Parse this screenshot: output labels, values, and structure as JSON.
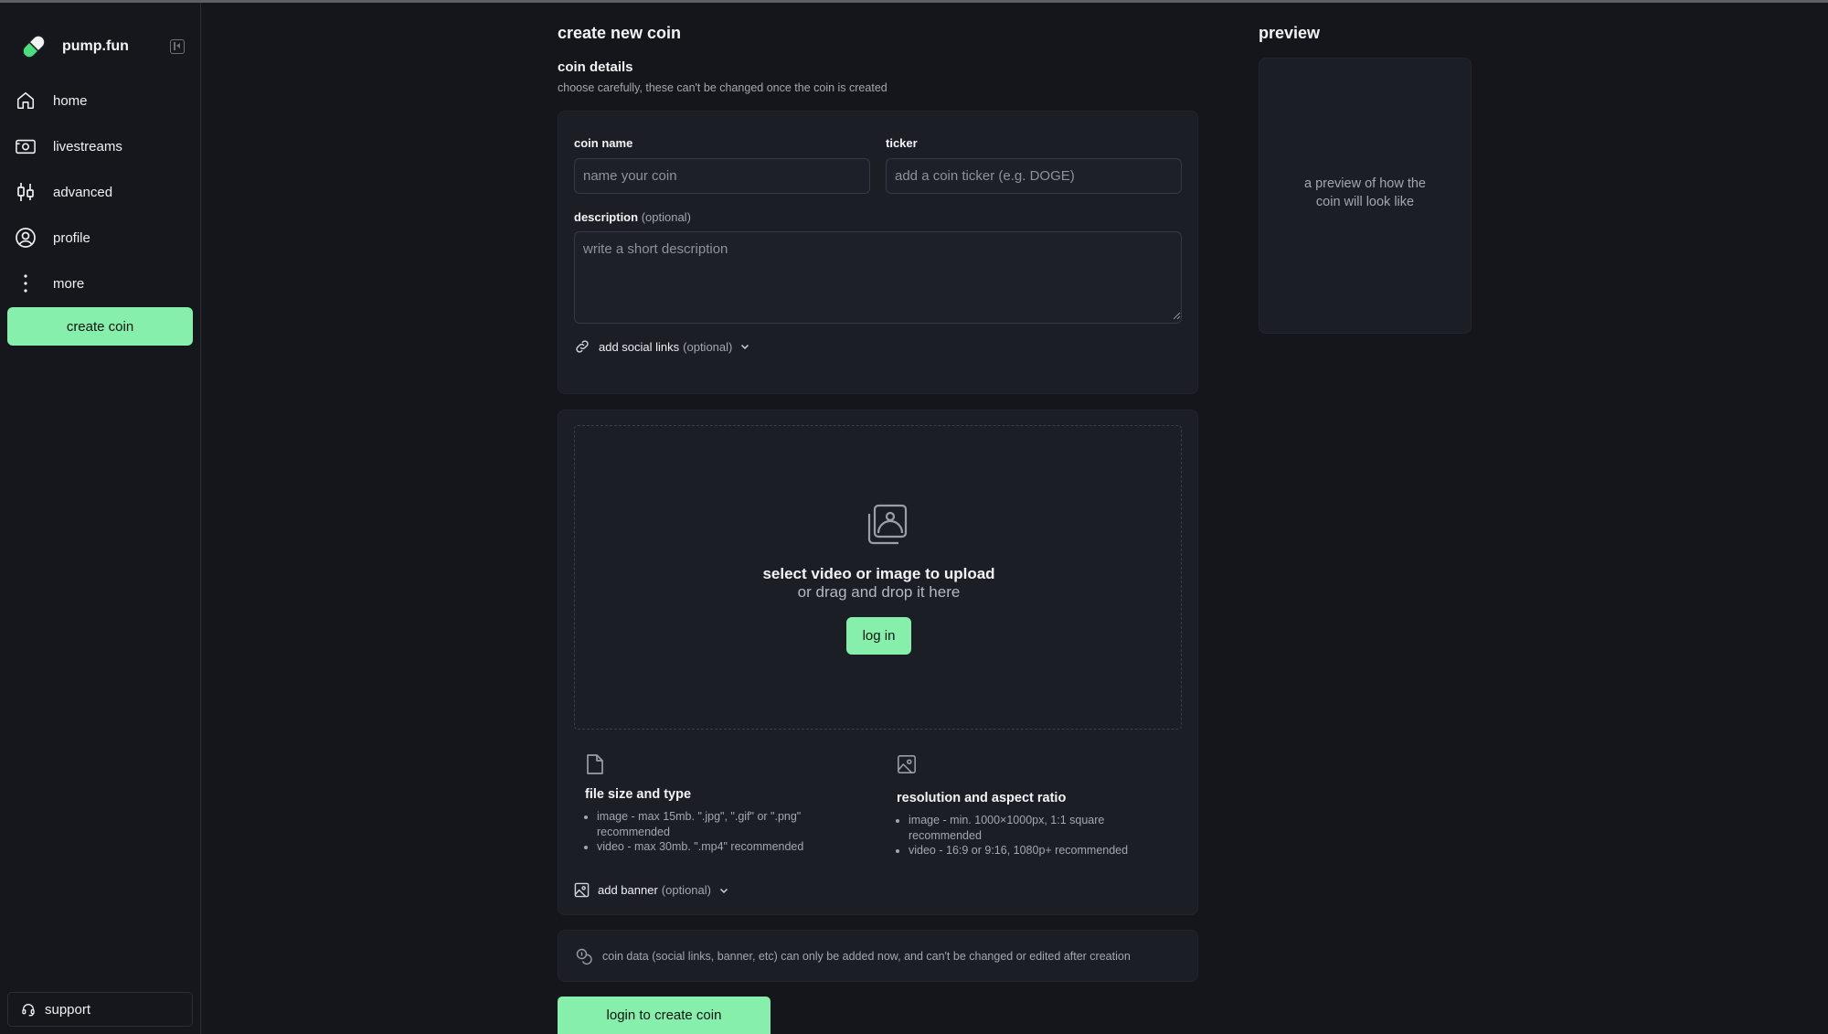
{
  "app": {
    "name": "pump.fun"
  },
  "sidebar": {
    "items": [
      {
        "label": "home",
        "icon": "home-icon"
      },
      {
        "label": "livestreams",
        "icon": "camera-icon"
      },
      {
        "label": "advanced",
        "icon": "candlestick-icon"
      },
      {
        "label": "profile",
        "icon": "user-circle-icon"
      },
      {
        "label": "more",
        "icon": "more-vertical-icon"
      }
    ],
    "create_label": "create coin",
    "support_label": "support"
  },
  "form": {
    "title": "create new coin",
    "section_title": "coin details",
    "section_subtitle": "choose carefully, these can't be changed once the coin is created",
    "coin_name_label": "coin name",
    "coin_name_placeholder": "name your coin",
    "ticker_label": "ticker",
    "ticker_placeholder": "add a coin ticker (e.g. DOGE)",
    "description_label": "description",
    "optional_text": "(optional)",
    "description_placeholder": "write a short description",
    "social_links_label": "add social links"
  },
  "upload": {
    "title": "select video or image to upload",
    "subtitle": "or drag and drop it here",
    "login_label": "log in",
    "file_info": {
      "title": "file size and type",
      "items": [
        "image - max 15mb. \".jpg\", \".gif\" or \".png\" recommended",
        "video - max 30mb. \".mp4\" recommended"
      ]
    },
    "resolution_info": {
      "title": "resolution and aspect ratio",
      "items": [
        "image - min. 1000×1000px, 1:1 square recommended",
        "video - 16:9 or 9:16, 1080p+ recommended"
      ]
    },
    "banner_label": "add banner"
  },
  "notice": {
    "text": "coin data (social links, banner, etc) can only be added now, and can't be changed or edited after creation"
  },
  "submit_label": "login to create coin",
  "preview": {
    "title": "preview",
    "placeholder": "a preview of how the coin will look like"
  },
  "colors": {
    "accent": "#86efac",
    "background": "#14161b",
    "card": "#1b1e25"
  }
}
